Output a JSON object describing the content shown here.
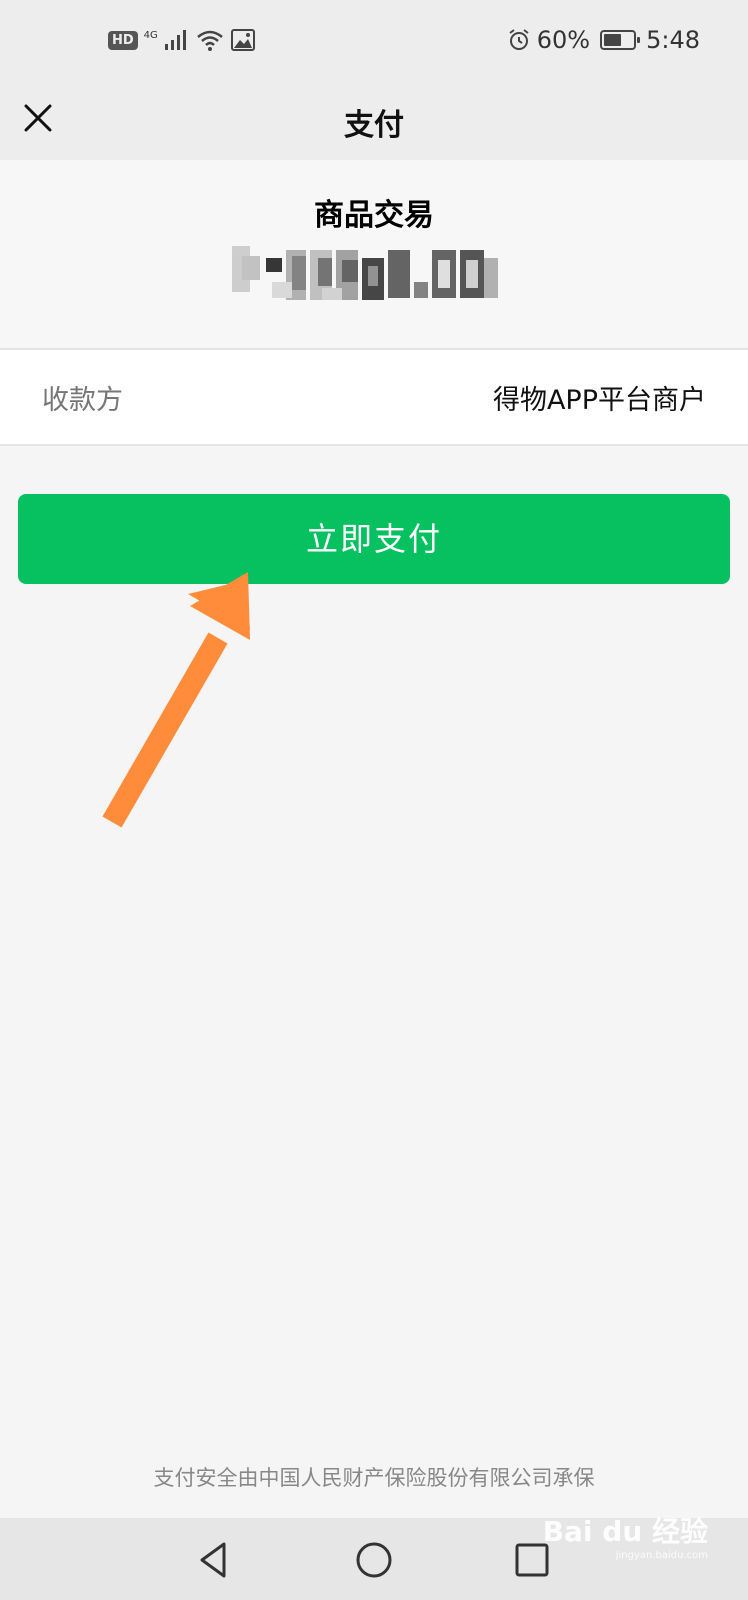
{
  "status_bar": {
    "hd_badge": "HD",
    "network": "4G",
    "battery_percent": "60%",
    "battery_level": 0.6,
    "time": "5:48",
    "icons": [
      "signal-icon",
      "wifi-icon",
      "image-alert-icon",
      "alarm-icon",
      "battery-icon"
    ]
  },
  "nav": {
    "title": "支付",
    "close_icon": "close-icon"
  },
  "payment": {
    "product_title": "商品交易"
  },
  "payee": {
    "label": "收款方",
    "value": "得物APP平台商户"
  },
  "action": {
    "pay_button": "立即支付"
  },
  "footer": {
    "note": "支付安全由中国人民财产保险股份有限公司承保"
  },
  "system_nav": {
    "icons": [
      "back-icon",
      "home-icon",
      "recents-icon"
    ]
  },
  "watermark": {
    "brand": "Bai du 经验",
    "url": "jingyan.baidu.com"
  },
  "colors": {
    "accent": "#07c160",
    "arrow": "#ff8c3a"
  }
}
